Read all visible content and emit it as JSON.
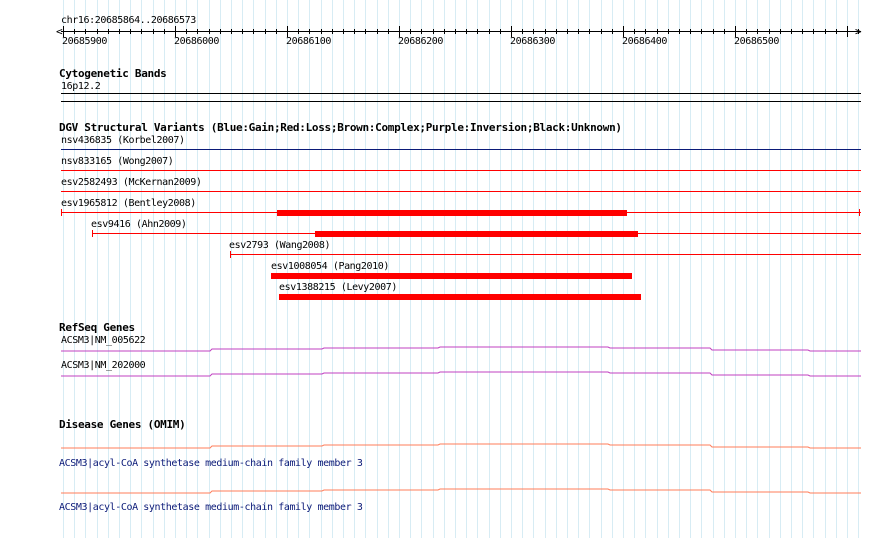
{
  "ruler": {
    "coordinates": "chr16:20685864..20686573",
    "ticks": [
      "20685900",
      "20686000",
      "20686100",
      "20686200",
      "20686300",
      "20686400",
      "20686500"
    ]
  },
  "cyto": {
    "title": "Cytogenetic Bands",
    "band": "16p12.2"
  },
  "dgv": {
    "title": "DGV Structural Variants (Blue:Gain;Red:Loss;Brown:Complex;Purple:Inversion;Black:Unknown)",
    "variants": [
      "nsv436835 (Korbel2007)",
      "nsv833165 (Wong2007)",
      "esv2582493 (McKernan2009)",
      "esv1965812 (Bentley2008)",
      "esv9416 (Ahn2009)",
      "esv2793 (Wang2008)",
      "esv1008054 (Pang2010)",
      "esv1388215 (Levy2007)"
    ]
  },
  "refseq": {
    "title": "RefSeq Genes",
    "genes": [
      "ACSM3|NM_005622",
      "ACSM3|NM_202000"
    ]
  },
  "omim": {
    "title": "Disease Genes (OMIM)",
    "genes": [
      "ACSM3|acyl-CoA synthetase medium-chain family member 3",
      "ACSM3|acyl-CoA synthetase medium-chain family member 3"
    ]
  },
  "colors": {
    "gain": "#0b1a78",
    "loss": "#ff0000",
    "refseq": "#c040c0",
    "omim": "#ff7d5a",
    "grid": "#d7ecf4"
  }
}
